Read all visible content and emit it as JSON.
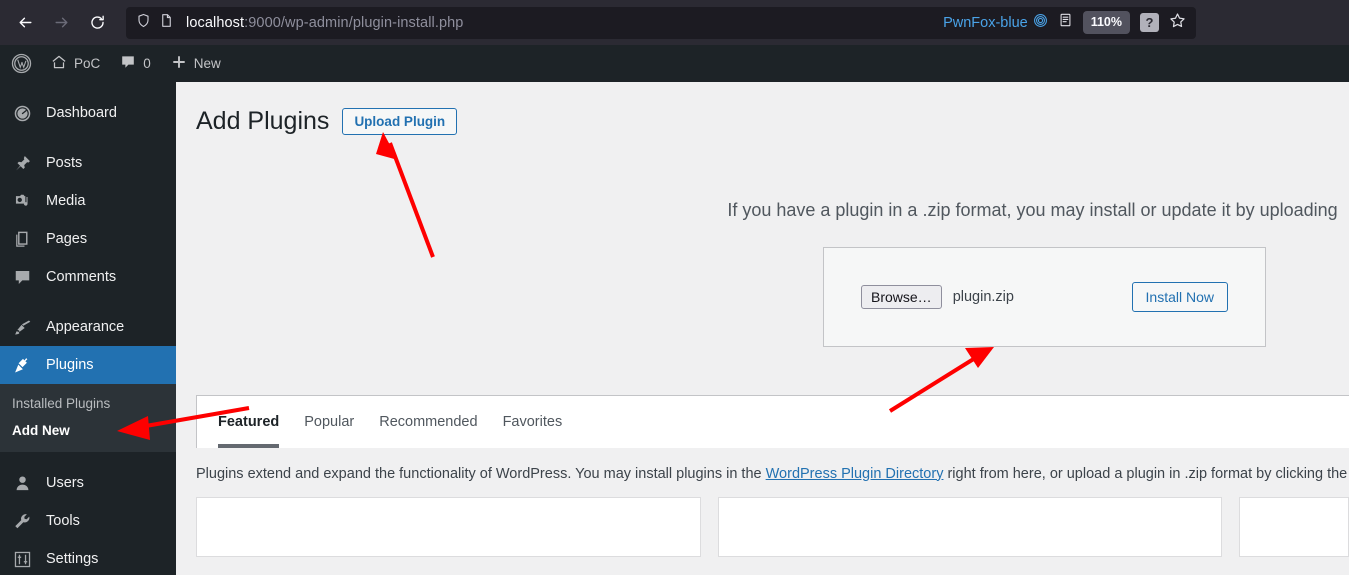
{
  "browser": {
    "back_icon": "arrow-left-icon",
    "forward_icon": "arrow-right-icon",
    "reload_icon": "reload-icon",
    "shield_icon": "shield-icon",
    "page_icon": "page-icon",
    "url_host": "localhost",
    "url_rest": ":9000/wp-admin/plugin-install.php",
    "extension_label": "PwnFox-blue",
    "extension_icon": "spiral-icon",
    "reader_icon": "reader-mode-icon",
    "zoom_level": "110%",
    "help_label": "?",
    "bookmark_icon": "star-icon",
    "accent_blue": "#4aa3e8",
    "chrome_bg": "#2b2a33",
    "urlbar_bg": "#1c1b22"
  },
  "adminbar": {
    "logo_icon": "wordpress-logo-icon",
    "items": [
      {
        "icon": "home-icon",
        "label": "PoC"
      },
      {
        "icon": "comment-icon",
        "label": "0"
      },
      {
        "icon": "plus-icon",
        "label": "New"
      }
    ]
  },
  "sidebar": {
    "bg": "#1d2327",
    "active_bg": "#2271b1",
    "items": [
      {
        "label": "Dashboard",
        "icon": "dashboard-icon",
        "active": false
      },
      {
        "label": "Posts",
        "icon": "pin-icon",
        "active": false
      },
      {
        "label": "Media",
        "icon": "media-icon",
        "active": false
      },
      {
        "label": "Pages",
        "icon": "pages-icon",
        "active": false
      },
      {
        "label": "Comments",
        "icon": "comment-icon",
        "active": false
      },
      {
        "label": "Appearance",
        "icon": "brush-icon",
        "active": false
      },
      {
        "label": "Plugins",
        "icon": "plug-icon",
        "active": true
      },
      {
        "label": "Users",
        "icon": "user-icon",
        "active": false
      },
      {
        "label": "Tools",
        "icon": "wrench-icon",
        "active": false
      },
      {
        "label": "Settings",
        "icon": "sliders-icon",
        "active": false
      }
    ],
    "submenu": [
      {
        "label": "Installed Plugins",
        "current": false
      },
      {
        "label": "Add New",
        "current": true
      }
    ]
  },
  "main": {
    "page_title": "Add Plugins",
    "upload_toggle_label": "Upload Plugin",
    "upload_hint": "If you have a plugin in a .zip format, you may install or update it by uploading",
    "browse_label": "Browse…",
    "file_name": "plugin.zip",
    "install_label": "Install Now",
    "tabs": [
      {
        "label": "Featured",
        "active": true
      },
      {
        "label": "Popular",
        "active": false
      },
      {
        "label": "Recommended",
        "active": false
      },
      {
        "label": "Favorites",
        "active": false
      }
    ],
    "desc_before": "Plugins extend and expand the functionality of WordPress. You may install plugins in the ",
    "desc_link": "WordPress Plugin Directory",
    "desc_after": " right from here, or upload a plugin in .zip format by clicking the but",
    "link_color": "#2271b1"
  },
  "annotations": {
    "arrow_color": "#fe0000",
    "arrow_1_target": "upload-plugin-button",
    "arrow_2_target": "file-upload-row",
    "arrow_3_target": "sidebar-add-new"
  }
}
